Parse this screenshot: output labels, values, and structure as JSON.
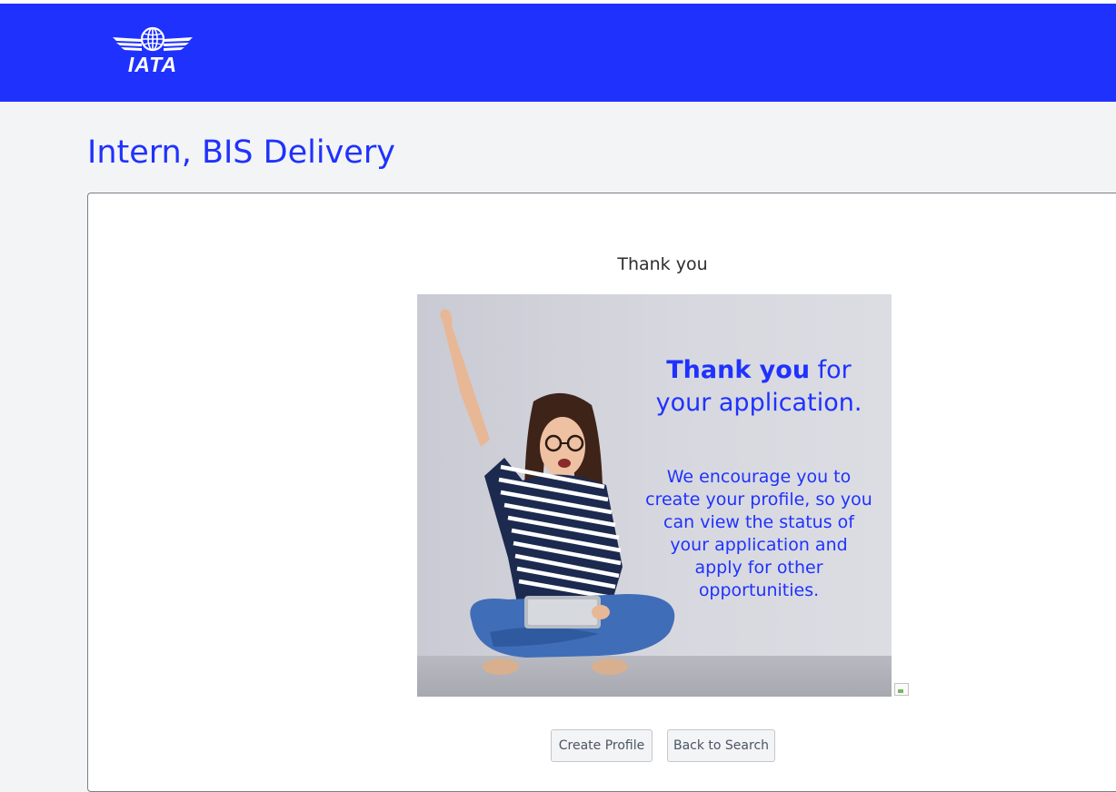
{
  "header": {
    "logo": {
      "text": "IATA",
      "icon": "iata-globe-wings-logo"
    },
    "background_color": "#1f32fd"
  },
  "page": {
    "title": "Intern, BIS Delivery"
  },
  "confirmation": {
    "heading": "Thank you",
    "banner": {
      "title_bold": "Thank you",
      "title_rest": " for your application.",
      "body": "We encourage you to create your profile, so you can view the status of your application and apply for other opportunities."
    },
    "broken_image_icon": "broken-image-icon"
  },
  "actions": {
    "create_profile_label": "Create Profile",
    "back_to_search_label": "Back to Search"
  }
}
